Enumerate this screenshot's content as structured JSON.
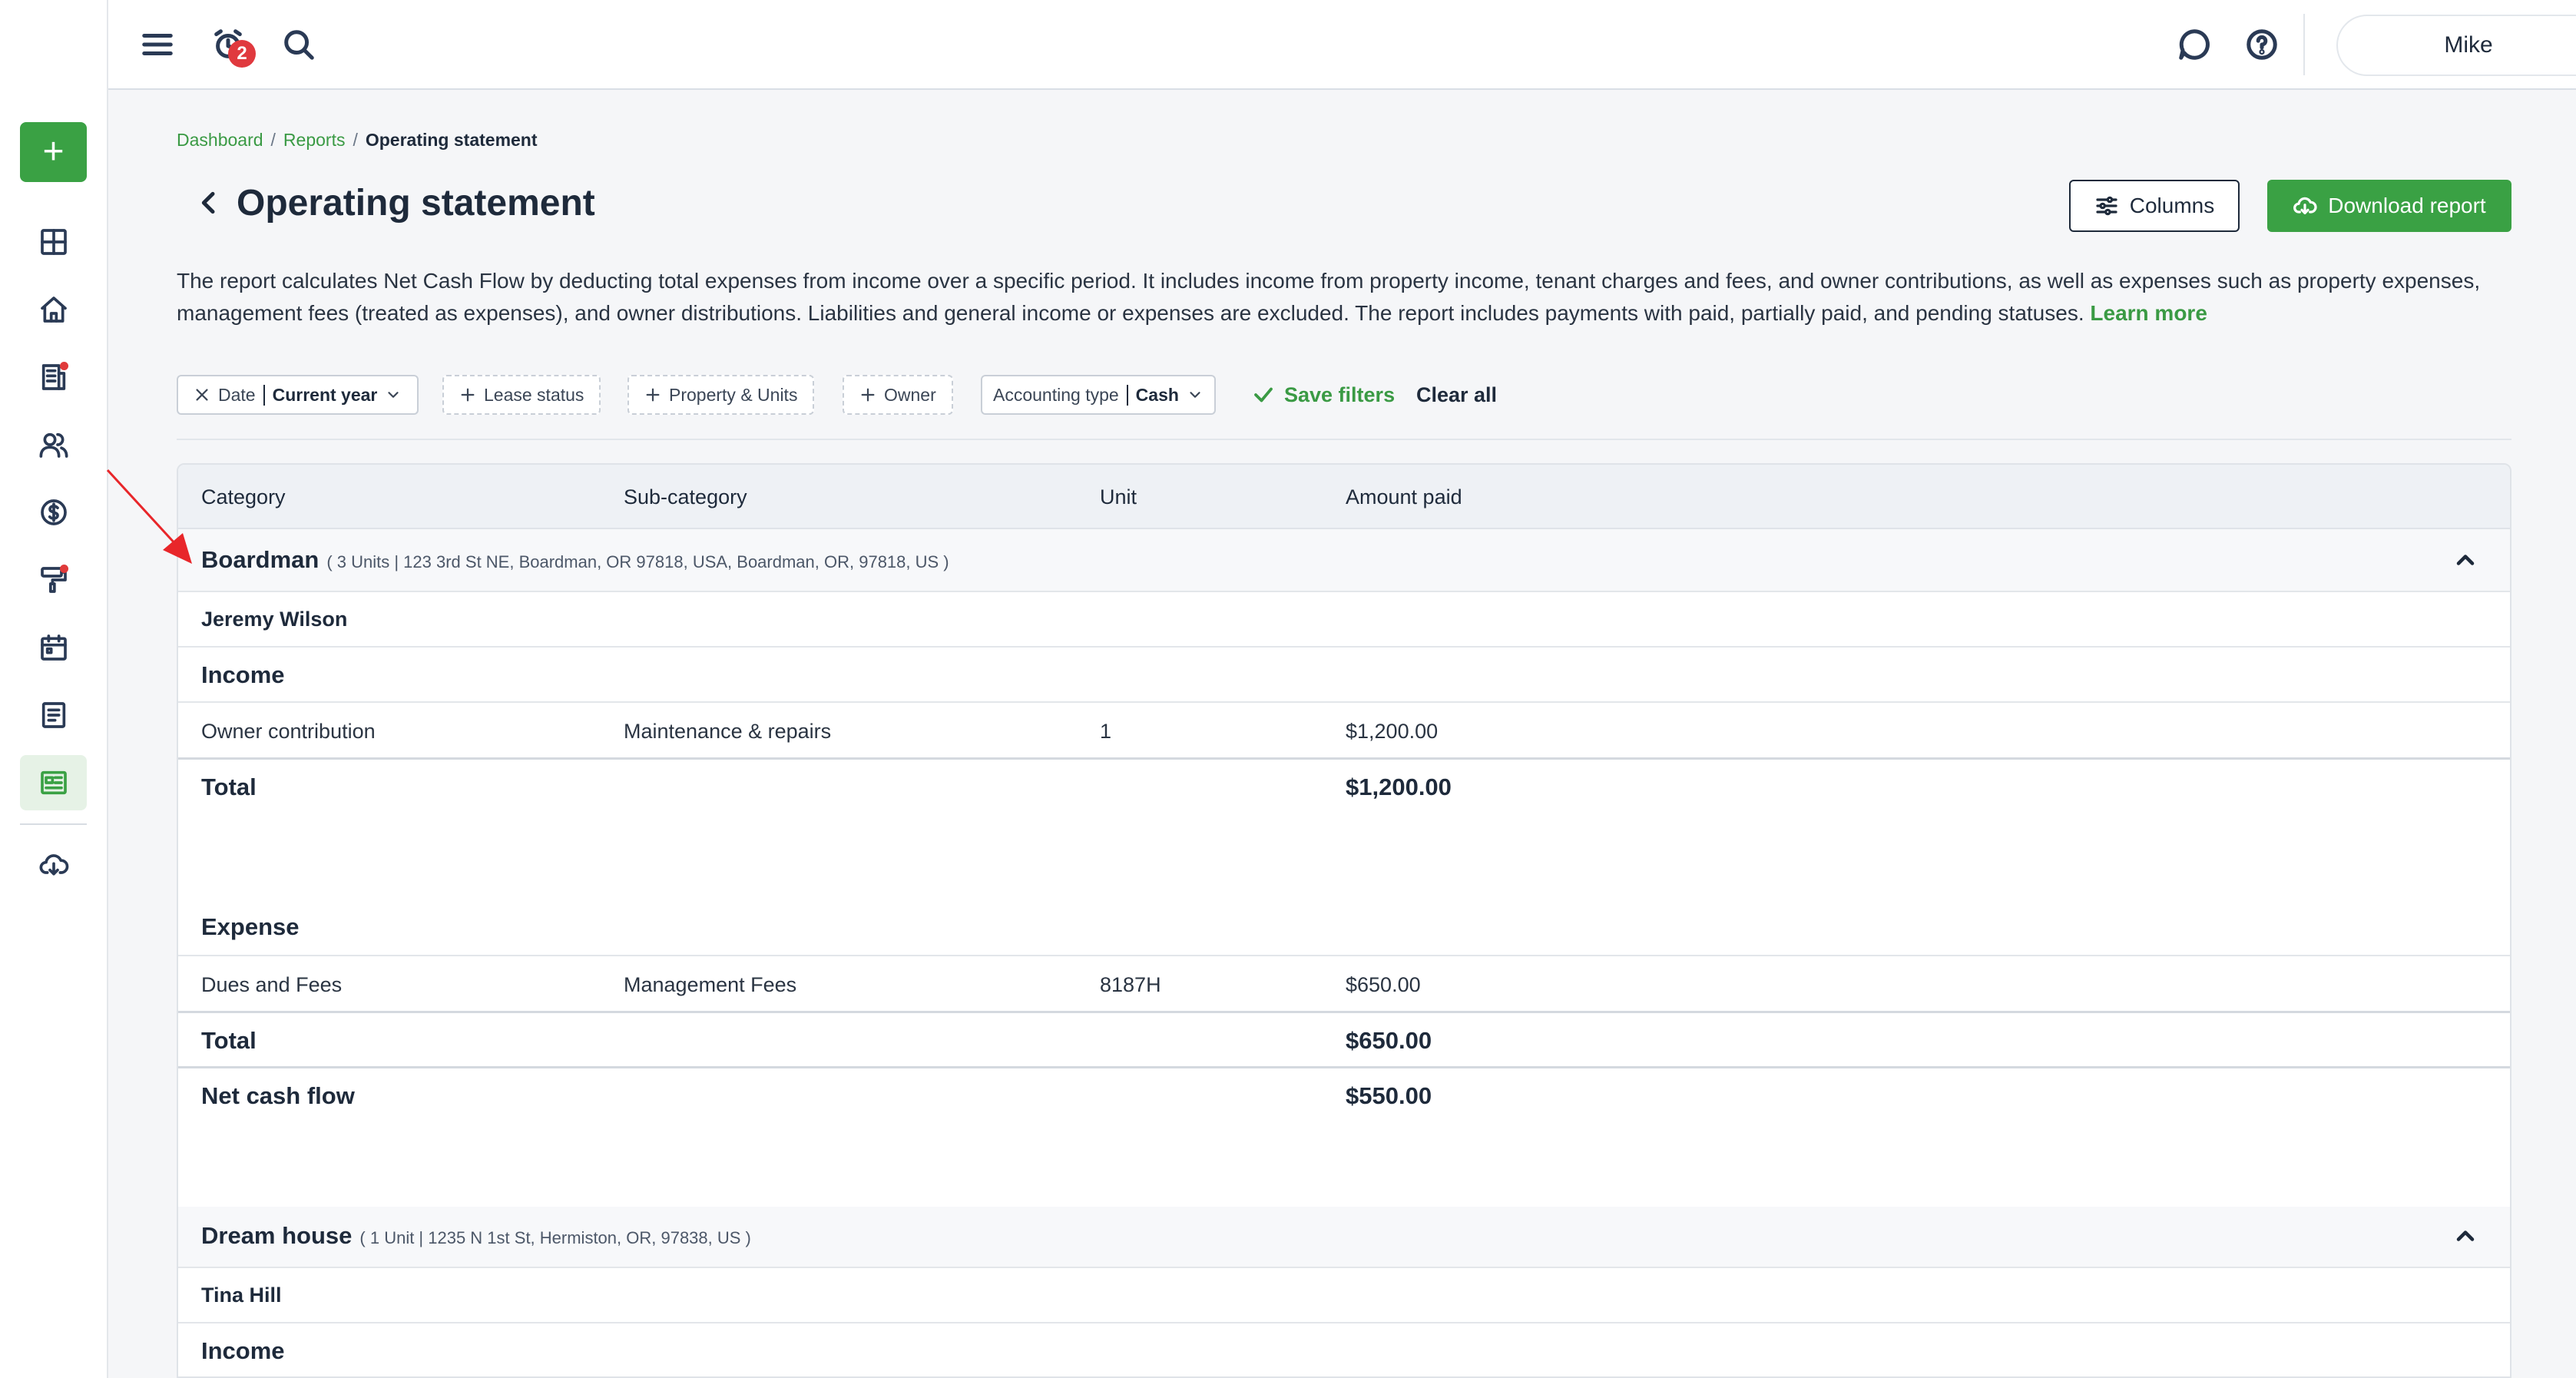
{
  "topbar": {
    "notification_count": "2",
    "user_name": "Mike"
  },
  "breadcrumb": {
    "items": [
      "Dashboard",
      "Reports"
    ],
    "current": "Operating statement",
    "separator": "/"
  },
  "page": {
    "title": "Operating statement",
    "columns_label": "Columns",
    "download_label": "Download report",
    "description": "The report calculates Net Cash Flow by deducting total expenses from income over a specific period. It includes income from property income, tenant charges and fees, and owner contributions, as well as expenses such as property expenses, management fees (treated as expenses), and owner distributions. Liabilities and general income or expenses are excluded. The report includes payments with paid, partially paid, and pending statuses.",
    "learn_more": "Learn more"
  },
  "filters": {
    "date_label": "Date",
    "date_value": "Current year",
    "lease_status": "Lease status",
    "property_units": "Property & Units",
    "owner": "Owner",
    "accounting_label": "Accounting type",
    "accounting_value": "Cash",
    "save_filters": "Save filters",
    "clear_all": "Clear all"
  },
  "table": {
    "headers": [
      "Category",
      "Sub-category",
      "Unit",
      "Amount paid"
    ],
    "groups": [
      {
        "name": "Boardman",
        "address": "( 3 Units | 123 3rd St NE, Boardman, OR 97818, USA, Boardman, OR, 97818, US )",
        "owner": "Jeremy Wilson",
        "income_label": "Income",
        "income_rows": [
          {
            "category": "Owner contribution",
            "subcategory": "Maintenance & repairs",
            "unit": "1",
            "amount": "$1,200.00"
          }
        ],
        "income_total_label": "Total",
        "income_total": "$1,200.00",
        "expense_label": "Expense",
        "expense_rows": [
          {
            "category": "Dues and Fees",
            "subcategory": "Management Fees",
            "unit": "8187H",
            "amount": "$650.00"
          }
        ],
        "expense_total_label": "Total",
        "expense_total": "$650.00",
        "net_label": "Net cash flow",
        "net_value": "$550.00"
      },
      {
        "name": "Dream house",
        "address": "( 1 Unit | 1235 N 1st St, Hermiston, OR, 97838, US )",
        "owner": "Tina Hill",
        "income_label": "Income"
      }
    ]
  },
  "colors": {
    "accent": "#3aa144",
    "badge": "#e0393e",
    "annotation": "#e8262a"
  },
  "icons": {
    "sidebar": [
      "plus-icon",
      "dashboard-icon",
      "home-icon",
      "building-icon",
      "people-icon",
      "dollar-icon",
      "paint-roller-icon",
      "calendar-icon",
      "document-icon",
      "report-icon",
      "cloud-download-icon"
    ],
    "topbar": [
      "menu-icon",
      "alarm-clock-icon",
      "search-icon",
      "chat-icon",
      "help-icon"
    ]
  }
}
